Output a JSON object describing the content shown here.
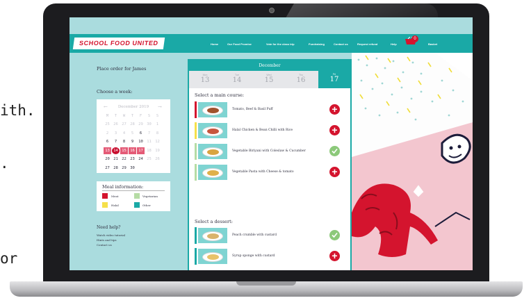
{
  "background_text": [
    "ith.",
    ".",
    "or"
  ],
  "header": {
    "logo": "SCHOOL FOOD UNITED",
    "nav": [
      "Home",
      "Our Food Promise",
      "Vote for the class trip",
      "Fundraising",
      "Contact us",
      "Request refund",
      "Help"
    ],
    "basket_count": "0",
    "basket_label": "Basket"
  },
  "left": {
    "order_title": "Place order for James",
    "choose_week": "Choose a week:",
    "calendar": {
      "month": "December 2019",
      "weekdays": [
        "M",
        "T",
        "W",
        "T",
        "F",
        "S",
        "S"
      ],
      "rows": [
        [
          "25",
          "26",
          "27",
          "28",
          "29",
          "30",
          "1"
        ],
        [
          "2",
          "3",
          "4",
          "5",
          "6",
          "7",
          "8"
        ],
        [
          "6",
          "7",
          "8",
          "9",
          "10",
          "11",
          "12"
        ],
        [
          "13",
          "14",
          "15",
          "16",
          "17",
          "18",
          "19"
        ],
        [
          "20",
          "21",
          "22",
          "23",
          "24",
          "25",
          "26"
        ],
        [
          "27",
          "28",
          "29",
          "30",
          "",
          "",
          ""
        ]
      ]
    },
    "meal_info": {
      "title": "Meal information:",
      "legend": [
        {
          "label": "Meat",
          "color": "#d4142e"
        },
        {
          "label": "Vegetarian",
          "color": "#b6dca5"
        },
        {
          "label": "Halal",
          "color": "#f5e04a"
        },
        {
          "label": "Other",
          "color": "#1aa9a6"
        }
      ]
    },
    "help": {
      "title": "Need help?",
      "links": [
        "Watch video tutorial",
        "Hints and tips",
        "Contact us"
      ]
    }
  },
  "panel": {
    "month": "December",
    "days": [
      {
        "name": "Mon",
        "date": "13"
      },
      {
        "name": "Tue",
        "date": "14"
      },
      {
        "name": "Wed",
        "date": "15"
      },
      {
        "name": "Thu",
        "date": "16"
      },
      {
        "name": "Fri",
        "date": "17"
      }
    ],
    "main_heading": "Select a main course:",
    "mains": [
      {
        "name": "Tomato, Beef & Basil Puff",
        "tag_color": "#d4142e",
        "food_color": "#a0522d",
        "state": "add"
      },
      {
        "name": "Halal Chicken & Bean Chilli with Rice",
        "tag_color": "#f5e04a",
        "food_color": "#c8553d",
        "state": "add"
      },
      {
        "name": "Vegetable Biriyani with Coleslaw & Cucumber",
        "tag_color": "#b6dca5",
        "food_color": "#d9a441",
        "state": "selected"
      },
      {
        "name": "Vegetable Pasta with Cheese & tomato",
        "tag_color": "#b6dca5",
        "food_color": "#e0b04a",
        "state": "add"
      }
    ],
    "dessert_heading": "Select a dessert:",
    "desserts": [
      {
        "name": "Peach crumble with custard",
        "tag_color": "#1aa9a6",
        "food_color": "#d9b36c",
        "state": "selected"
      },
      {
        "name": "Syrup sponge with custard",
        "tag_color": "#1aa9a6",
        "food_color": "#e8c26a",
        "state": "add"
      }
    ]
  },
  "colors": {
    "teal": "#1aa9a6",
    "red": "#d4142e",
    "light_teal": "#aadcde"
  }
}
